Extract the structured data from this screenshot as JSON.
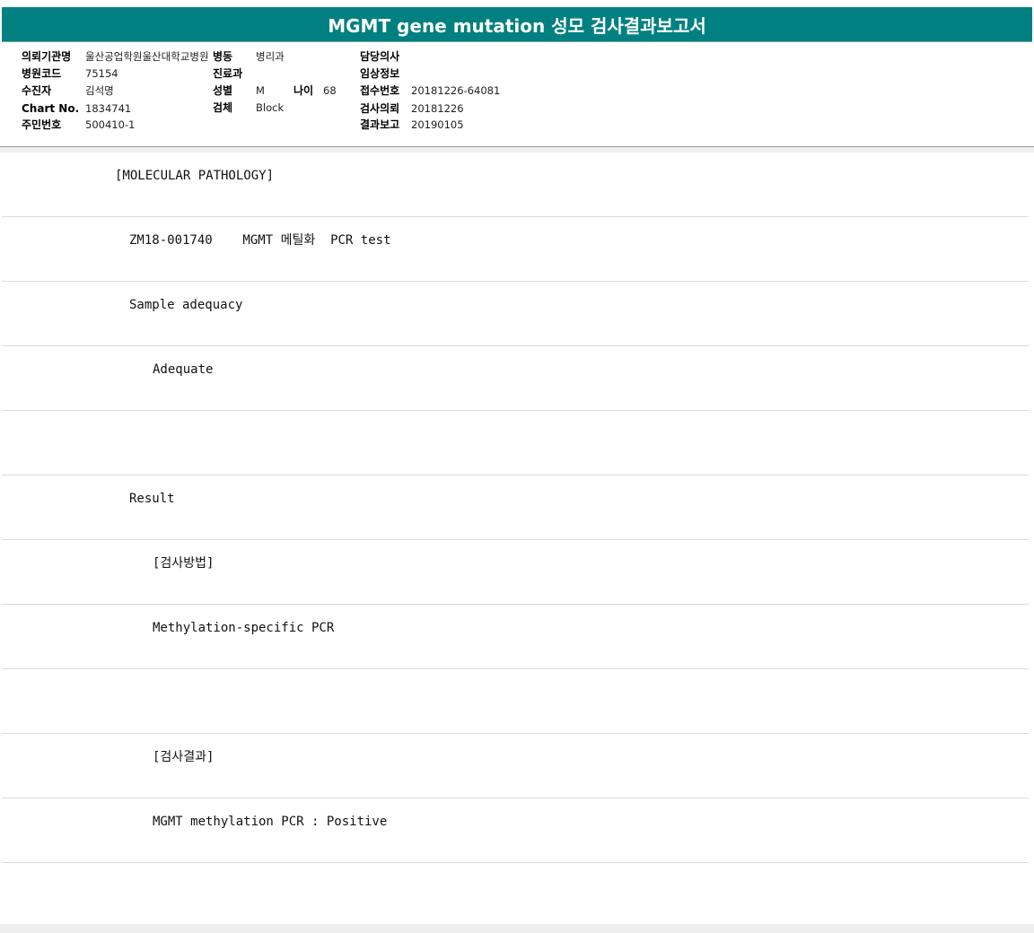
{
  "title": "MGMT gene mutation 성모 검사결과보고서",
  "header": {
    "institution_label": "의뢰기관명",
    "institution_value": "울산공업학원울산대학교병원",
    "ward_label": "병동",
    "ward_value": "병리과",
    "doctor_label": "담당의사",
    "doctor_value": "",
    "hospital_code_label": "병원코드",
    "hospital_code_value": "75154",
    "department_label": "진료과",
    "department_value": "",
    "clinical_info_label": "임상정보",
    "clinical_info_value": "",
    "patient_label": "수진자",
    "patient_value": "김석명",
    "sex_label": "성별",
    "sex_value": "M",
    "age_label": "나이",
    "age_value": "68",
    "accession_label": "접수번호",
    "accession_value": "20181226-64081",
    "chart_label": "Chart No.",
    "chart_value": "1834741",
    "specimen_label": "검체",
    "specimen_value": "Block",
    "request_label": "검사의뢰",
    "request_value": "20181226",
    "resident_label": "주민번호",
    "resident_value": "500410-1",
    "report_label": "결과보고",
    "report_value": "20190105"
  },
  "report": {
    "lines": [
      "[MOLECULAR PATHOLOGY]",
      "ZM18-001740    MGMT 메틸화  PCR test",
      "Sample adequacy",
      "Adequate",
      "",
      "Result",
      "[검사방법]",
      "Methylation-specific PCR",
      "",
      "[검사결과]",
      "MGMT methylation PCR : Positive",
      ""
    ]
  }
}
